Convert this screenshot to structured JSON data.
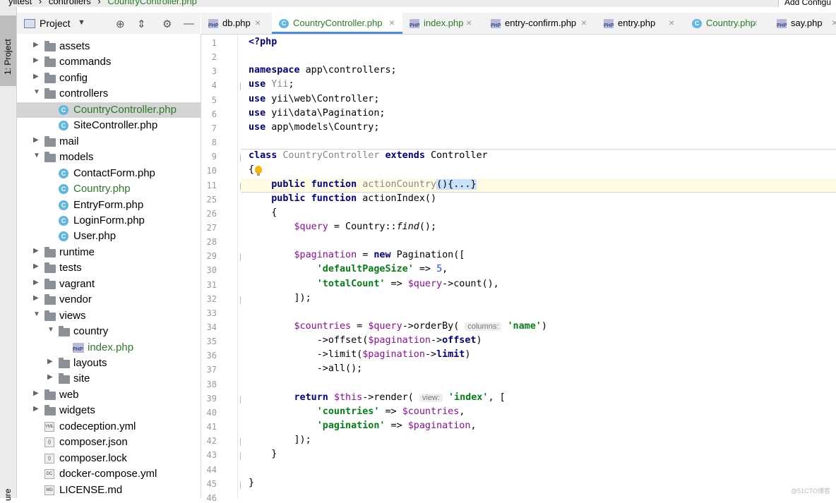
{
  "breadcrumb": {
    "items": [
      "yiitest",
      "controllers"
    ],
    "file": "CountryController.php"
  },
  "run_config_button": "Add Configu",
  "toolstrip": {
    "project_label": "1: Project",
    "bottom_label": "ure"
  },
  "project_panel": {
    "title": "Project",
    "icons": [
      "target-icon",
      "collapse-icon",
      "gear-icon",
      "minimize-icon"
    ]
  },
  "tree": [
    {
      "label": "assets",
      "type": "folder",
      "depth": 1,
      "expanded": false
    },
    {
      "label": "commands",
      "type": "folder",
      "depth": 1,
      "expanded": false
    },
    {
      "label": "config",
      "type": "folder",
      "depth": 1,
      "expanded": false
    },
    {
      "label": "controllers",
      "type": "folder",
      "depth": 1,
      "expanded": true
    },
    {
      "label": "CountryController.php",
      "type": "class",
      "depth": 2,
      "selected": true,
      "green": true
    },
    {
      "label": "SiteController.php",
      "type": "class",
      "depth": 2
    },
    {
      "label": "mail",
      "type": "folder",
      "depth": 1,
      "expanded": false
    },
    {
      "label": "models",
      "type": "folder",
      "depth": 1,
      "expanded": true
    },
    {
      "label": "ContactForm.php",
      "type": "class",
      "depth": 2
    },
    {
      "label": "Country.php",
      "type": "class",
      "depth": 2,
      "green": true
    },
    {
      "label": "EntryForm.php",
      "type": "class",
      "depth": 2
    },
    {
      "label": "LoginForm.php",
      "type": "class",
      "depth": 2
    },
    {
      "label": "User.php",
      "type": "class",
      "depth": 2
    },
    {
      "label": "runtime",
      "type": "folder",
      "depth": 1,
      "expanded": false
    },
    {
      "label": "tests",
      "type": "folder",
      "depth": 1,
      "expanded": false
    },
    {
      "label": "vagrant",
      "type": "folder",
      "depth": 1,
      "expanded": false
    },
    {
      "label": "vendor",
      "type": "folder",
      "depth": 1,
      "expanded": false
    },
    {
      "label": "views",
      "type": "folder",
      "depth": 1,
      "expanded": true
    },
    {
      "label": "country",
      "type": "folder",
      "depth": 2,
      "expanded": true
    },
    {
      "label": "index.php",
      "type": "php",
      "depth": 3,
      "green": true
    },
    {
      "label": "layouts",
      "type": "folder",
      "depth": 2,
      "expanded": false
    },
    {
      "label": "site",
      "type": "folder",
      "depth": 2,
      "expanded": false
    },
    {
      "label": "web",
      "type": "folder",
      "depth": 1,
      "expanded": false
    },
    {
      "label": "widgets",
      "type": "folder",
      "depth": 1,
      "expanded": false
    },
    {
      "label": "codeception.yml",
      "type": "file",
      "badge": "YML",
      "depth": 1
    },
    {
      "label": "composer.json",
      "type": "file",
      "badge": "{}",
      "depth": 1
    },
    {
      "label": "composer.lock",
      "type": "file",
      "badge": "{}",
      "depth": 1
    },
    {
      "label": "docker-compose.yml",
      "type": "file",
      "badge": "DC",
      "depth": 1
    },
    {
      "label": "LICENSE.md",
      "type": "file",
      "badge": "MD",
      "depth": 1
    }
  ],
  "tabs": [
    {
      "label": "db.php",
      "type": "php",
      "active": false,
      "green": false
    },
    {
      "label": "CountryController.php",
      "type": "class",
      "active": true,
      "green": true
    },
    {
      "label": "index.php",
      "type": "php",
      "active": false,
      "green": true
    },
    {
      "label": "entry-confirm.php",
      "type": "php",
      "active": false,
      "green": false
    },
    {
      "label": "entry.php",
      "type": "php",
      "active": false,
      "green": false
    },
    {
      "label": "Country.php",
      "type": "class",
      "active": false,
      "green": true
    },
    {
      "label": "say.php",
      "type": "php",
      "active": false,
      "green": false
    }
  ],
  "tab_close_glyph": "×",
  "code": {
    "line_numbers": [
      "1",
      "2",
      "3",
      "4",
      "5",
      "6",
      "7",
      "8",
      "9",
      "10",
      "11",
      "25",
      "26",
      "27",
      "28",
      "29",
      "30",
      "31",
      "32",
      "33",
      "34",
      "35",
      "36",
      "37",
      "38",
      "39",
      "40",
      "41",
      "42",
      "43",
      "44",
      "45",
      "46"
    ],
    "lines": [
      [
        {
          "t": "<?php",
          "c": "kw"
        }
      ],
      [],
      [
        {
          "t": "namespace",
          "c": "kw"
        },
        {
          "t": " app\\controllers;"
        }
      ],
      [
        {
          "t": "use",
          "c": "kw"
        },
        {
          "t": " "
        },
        {
          "t": "Yii",
          "c": "dim"
        },
        {
          "t": ";"
        }
      ],
      [
        {
          "t": "use",
          "c": "kw"
        },
        {
          "t": " yii\\web\\Controller;"
        }
      ],
      [
        {
          "t": "use",
          "c": "kw"
        },
        {
          "t": " yii\\data\\Pagination;"
        }
      ],
      [
        {
          "t": "use",
          "c": "kw"
        },
        {
          "t": " app\\models\\Country;"
        }
      ],
      [],
      [
        {
          "t": "class",
          "c": "kw"
        },
        {
          "t": " "
        },
        {
          "t": "CountryController",
          "c": "dim"
        },
        {
          "t": " "
        },
        {
          "t": "extends",
          "c": "kw"
        },
        {
          "t": " Controller"
        }
      ],
      [
        {
          "t": "{"
        }
      ],
      [
        {
          "t": "    "
        },
        {
          "t": "public function",
          "c": "kw"
        },
        {
          "t": " "
        },
        {
          "t": "actionCountry",
          "c": "dim"
        },
        {
          "t": "(){",
          "c": "brk"
        },
        {
          "t": "...",
          "c": "brk"
        },
        {
          "t": "}",
          "c": "brk"
        }
      ],
      [
        {
          "t": "    "
        },
        {
          "t": "public function",
          "c": "kw"
        },
        {
          "t": " actionIndex()"
        }
      ],
      [
        {
          "t": "    {"
        }
      ],
      [
        {
          "t": "        "
        },
        {
          "t": "$query",
          "c": "var"
        },
        {
          "t": " = Country::"
        },
        {
          "t": "find",
          "c": "it"
        },
        {
          "t": "();"
        }
      ],
      [],
      [
        {
          "t": "        "
        },
        {
          "t": "$pagination",
          "c": "var"
        },
        {
          "t": " = "
        },
        {
          "t": "new",
          "c": "kw"
        },
        {
          "t": " Pagination(["
        }
      ],
      [
        {
          "t": "            "
        },
        {
          "t": "'defaultPageSize'",
          "c": "str"
        },
        {
          "t": " => "
        },
        {
          "t": "5",
          "c": "num"
        },
        {
          "t": ","
        }
      ],
      [
        {
          "t": "            "
        },
        {
          "t": "'totalCount'",
          "c": "str"
        },
        {
          "t": " => "
        },
        {
          "t": "$query",
          "c": "var"
        },
        {
          "t": "->count(),"
        }
      ],
      [
        {
          "t": "        ]);"
        }
      ],
      [],
      [
        {
          "t": "        "
        },
        {
          "t": "$countries",
          "c": "var"
        },
        {
          "t": " = "
        },
        {
          "t": "$query",
          "c": "var"
        },
        {
          "t": "->orderBy( "
        },
        {
          "t": "columns:",
          "c": "hint"
        },
        {
          "t": " "
        },
        {
          "t": "'name'",
          "c": "str"
        },
        {
          "t": ")"
        }
      ],
      [
        {
          "t": "            ->offset("
        },
        {
          "t": "$pagination",
          "c": "var"
        },
        {
          "t": "->"
        },
        {
          "t": "offset",
          "c": "kw"
        },
        {
          "t": ")"
        }
      ],
      [
        {
          "t": "            ->limit("
        },
        {
          "t": "$pagination",
          "c": "var"
        },
        {
          "t": "->"
        },
        {
          "t": "limit",
          "c": "kw"
        },
        {
          "t": ")"
        }
      ],
      [
        {
          "t": "            ->all();"
        }
      ],
      [],
      [
        {
          "t": "        "
        },
        {
          "t": "return",
          "c": "kw"
        },
        {
          "t": " "
        },
        {
          "t": "$this",
          "c": "var"
        },
        {
          "t": "->render( "
        },
        {
          "t": "view:",
          "c": "hint"
        },
        {
          "t": " "
        },
        {
          "t": "'index'",
          "c": "str"
        },
        {
          "t": ", ["
        }
      ],
      [
        {
          "t": "            "
        },
        {
          "t": "'countries'",
          "c": "str"
        },
        {
          "t": " => "
        },
        {
          "t": "$countries",
          "c": "var"
        },
        {
          "t": ","
        }
      ],
      [
        {
          "t": "            "
        },
        {
          "t": "'pagination'",
          "c": "str"
        },
        {
          "t": " => "
        },
        {
          "t": "$pagination",
          "c": "var"
        },
        {
          "t": ","
        }
      ],
      [
        {
          "t": "        ]);"
        }
      ],
      [
        {
          "t": "    }"
        }
      ],
      [],
      [
        {
          "t": "}"
        }
      ],
      []
    ],
    "highlight_line_index": 10,
    "bulb_line_index": 9,
    "separator_line_indices": [
      8,
      11
    ]
  },
  "watermark": "@51CTO博客"
}
